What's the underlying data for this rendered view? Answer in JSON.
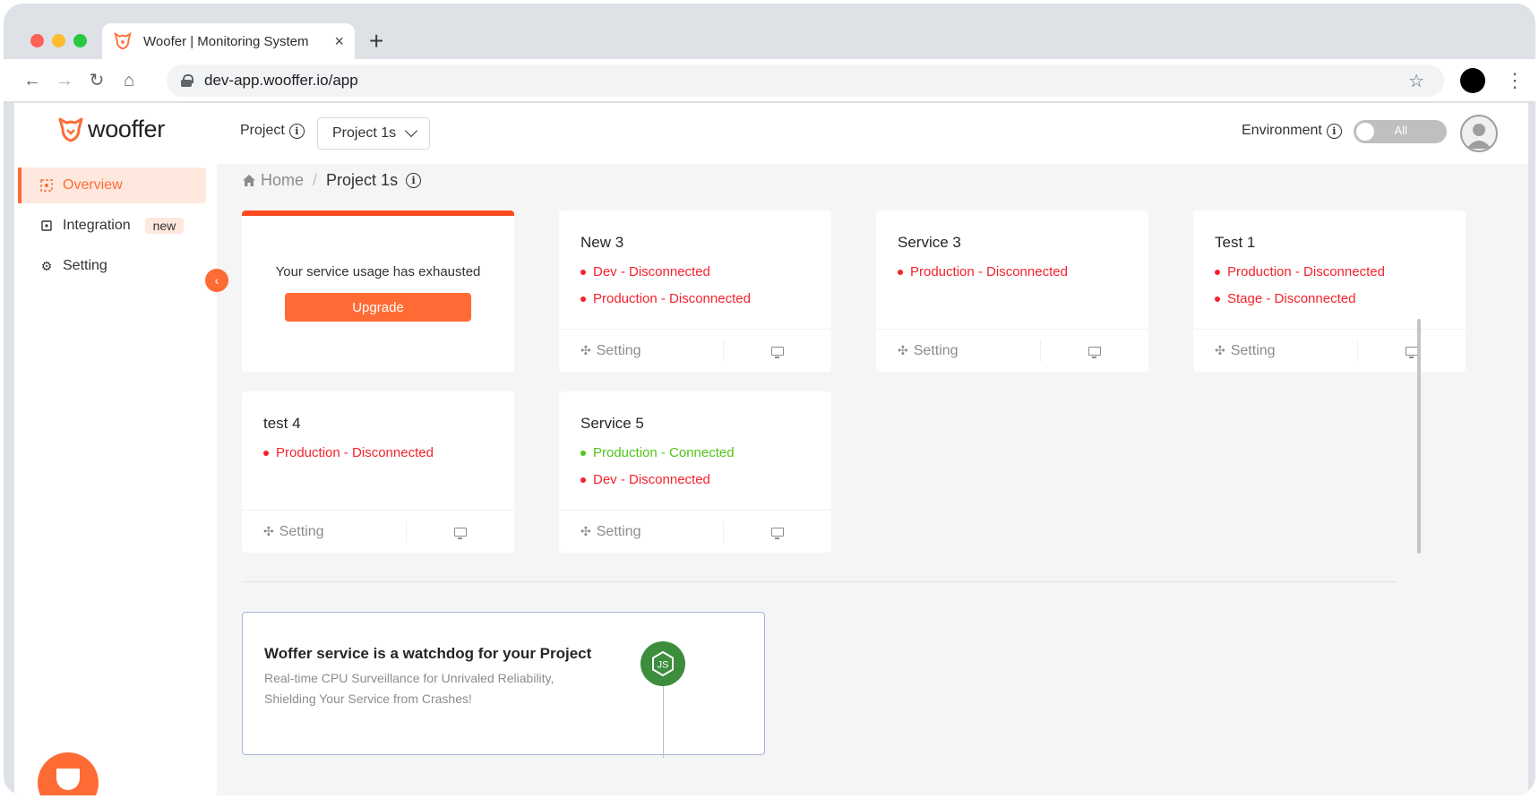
{
  "browser": {
    "tab_title": "Woofer | Monitoring System",
    "tab_close": "×",
    "new_tab": "+",
    "url": "dev-app.wooffer.io/app"
  },
  "header": {
    "logo_text": "wooffer",
    "project_label": "Project",
    "project_selected": "Project 1s",
    "environment_label": "Environment",
    "environment_toggle": "All"
  },
  "sidebar": {
    "items": [
      {
        "label": "Overview",
        "icon": "overview-icon",
        "active": true
      },
      {
        "label": "Integration",
        "icon": "integration-icon",
        "badge": "new"
      },
      {
        "label": "Setting",
        "icon": "gear-icon"
      }
    ]
  },
  "breadcrumb": {
    "home": "Home",
    "separator": "/",
    "current": "Project 1s"
  },
  "upgrade_card": {
    "message": "Your service usage has exhausted",
    "button": "Upgrade"
  },
  "cards": [
    {
      "title": "New 3",
      "statuses": [
        {
          "text": "Dev - Disconnected",
          "state": "disconnected"
        },
        {
          "text": "Production - Disconnected",
          "state": "disconnected"
        }
      ],
      "setting": "Setting"
    },
    {
      "title": "Service 3",
      "statuses": [
        {
          "text": "Production - Disconnected",
          "state": "disconnected"
        }
      ],
      "setting": "Setting"
    },
    {
      "title": "Test 1",
      "statuses": [
        {
          "text": "Production - Disconnected",
          "state": "disconnected"
        },
        {
          "text": "Stage - Disconnected",
          "state": "disconnected"
        }
      ],
      "setting": "Setting"
    },
    {
      "title": "test 4",
      "statuses": [
        {
          "text": "Production - Disconnected",
          "state": "disconnected"
        }
      ],
      "setting": "Setting"
    },
    {
      "title": "Service 5",
      "statuses": [
        {
          "text": "Production - Connected",
          "state": "connected"
        },
        {
          "text": "Dev - Disconnected",
          "state": "disconnected"
        }
      ],
      "setting": "Setting"
    }
  ],
  "promo": {
    "title": "Woffer service is a watchdog for your Project",
    "subtitle_line1": "Real-time CPU Surveillance for Unrivaled Reliability,",
    "subtitle_line2": "Shielding Your Service from Crashes!",
    "badge_text": "JS"
  },
  "colors": {
    "accent": "#ff6b35",
    "disconnected": "#f5222d",
    "connected": "#52c41a",
    "node_green": "#3c8d3c"
  }
}
